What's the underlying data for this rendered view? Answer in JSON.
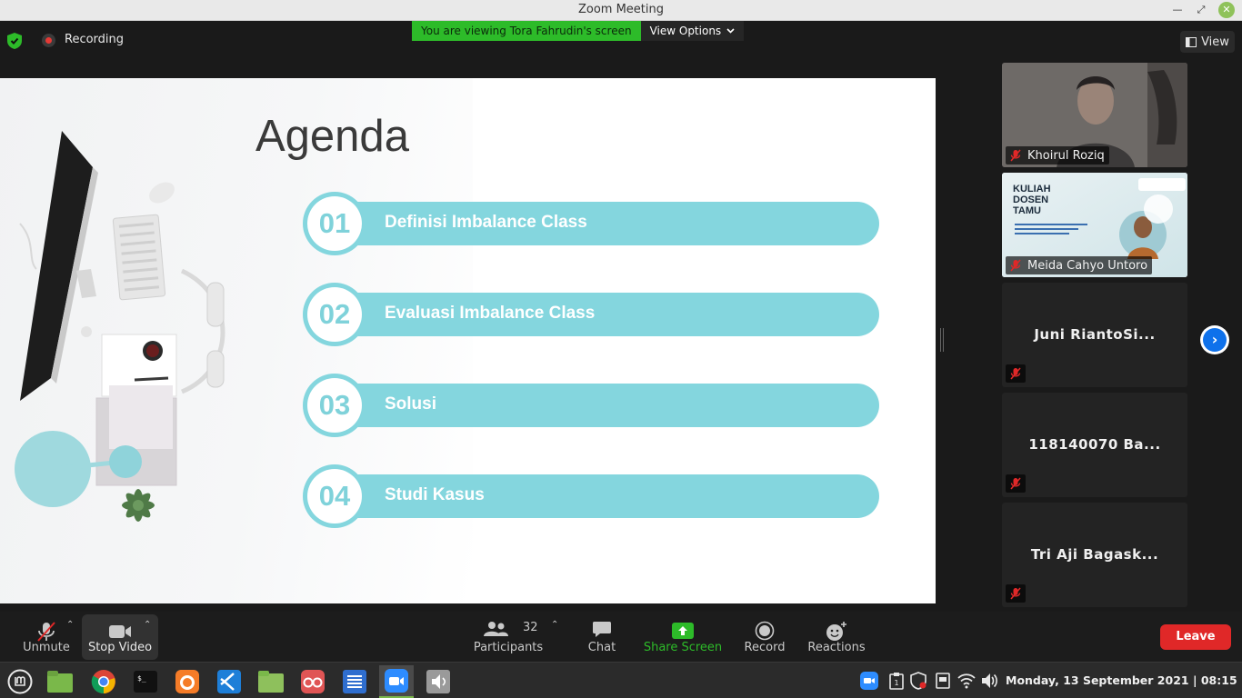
{
  "window": {
    "title": "Zoom Meeting"
  },
  "meeting": {
    "recording_label": "Recording",
    "viewing_text": "You are viewing Tora Fahrudin's screen",
    "view_options_label": "View Options",
    "view_label": "View"
  },
  "slide": {
    "title": "Agenda",
    "items": [
      {
        "number": "01",
        "label": "Definisi Imbalance Class"
      },
      {
        "number": "02",
        "label": "Evaluasi Imbalance Class"
      },
      {
        "number": "03",
        "label": "Solusi"
      },
      {
        "number": "04",
        "label": "Studi Kasus"
      }
    ],
    "accent_color": "#84d6de"
  },
  "participants_gallery": [
    {
      "name": "Khoirul Roziq",
      "video": true,
      "muted": true
    },
    {
      "name": "Meida Cahyo Untoro",
      "video": true,
      "muted": true,
      "video_text": {
        "line1": "KULIAH",
        "line2": "DOSEN",
        "line3": "TAMU"
      }
    },
    {
      "name": "Juni RiantoSi...",
      "video": false,
      "muted": true
    },
    {
      "name": "118140070 Ba...",
      "video": false,
      "muted": true
    },
    {
      "name": "Tri Aji Bagask...",
      "video": false,
      "muted": true
    }
  ],
  "controls": {
    "unmute_label": "Unmute",
    "stop_video_label": "Stop Video",
    "participants_label": "Participants",
    "participants_count": "32",
    "chat_label": "Chat",
    "share_screen_label": "Share Screen",
    "record_label": "Record",
    "reactions_label": "Reactions",
    "leave_label": "Leave"
  },
  "taskbar": {
    "apps": [
      "menu-icon",
      "files-icon",
      "chrome-icon",
      "terminal-icon",
      "firefox-icon",
      "vscode-icon",
      "folder-icon",
      "glasses-icon",
      "text-editor-icon",
      "zoom-icon",
      "sound-icon"
    ],
    "datetime": "Monday, 13 September 2021   |   08:15"
  },
  "colors": {
    "zoom_green": "#2dbb29",
    "leave_red": "#e02828",
    "zoom_blue": "#0e71eb"
  }
}
